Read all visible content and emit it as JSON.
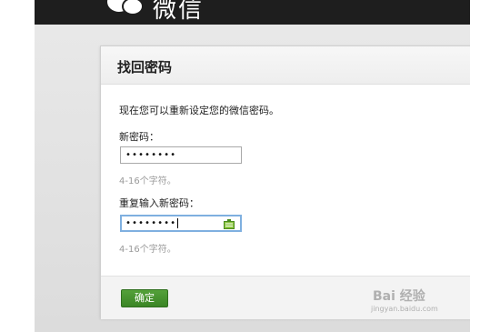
{
  "header": {
    "app_name": "微信"
  },
  "card": {
    "title": "找回密码",
    "intro": "现在您可以重新设定您的微信密码。",
    "new_password": {
      "label": "新密码：",
      "value": "••••••••",
      "hint": "4-16个字符。"
    },
    "repeat_password": {
      "label": "重复输入新密码：",
      "value": "••••••••",
      "hint": "4-16个字符。"
    },
    "confirm_label": "确定"
  },
  "watermark": {
    "text": "Bai 经验",
    "sub": "jingyan.baidu.com"
  },
  "colors": {
    "confirm_green": "#3a8525",
    "topbar": "#1e1e1e",
    "focus_border": "#7fb0e0"
  }
}
